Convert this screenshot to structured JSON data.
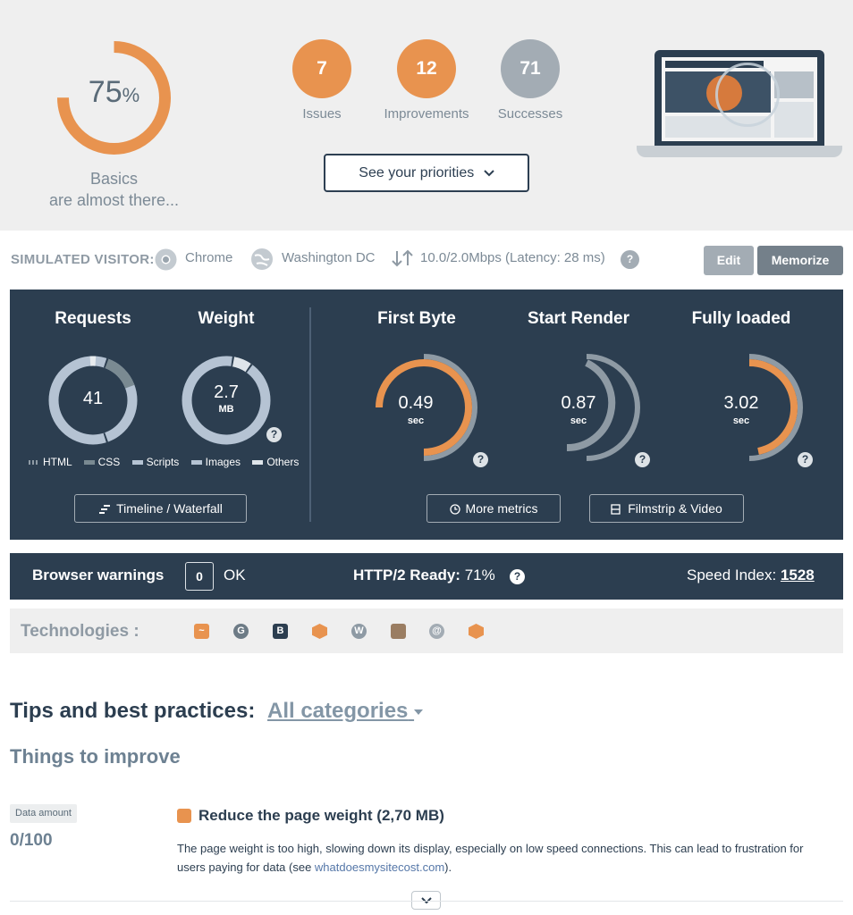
{
  "summary": {
    "score": "75",
    "score_unit": "%",
    "score_fraction": 0.75,
    "basics_line1": "Basics",
    "basics_line2": "are almost there...",
    "issues_count": "7",
    "issues_label": "Issues",
    "improvements_count": "12",
    "improvements_label": "Improvements",
    "successes_count": "71",
    "successes_label": "Successes",
    "priorities_button": "See your priorities"
  },
  "visitor": {
    "label": "SIMULATED VISITOR:",
    "browser": "Chrome",
    "location": "Washington DC",
    "connection": "10.0/2.0Mbps (Latency: 28 ms)",
    "edit_button": "Edit",
    "memorize_button": "Memorize"
  },
  "metrics": {
    "requests_title": "Requests",
    "requests_value": "41",
    "weight_title": "Weight",
    "weight_value": "2.7",
    "weight_unit": "MB",
    "legend": [
      "HTML",
      "CSS",
      "Scripts",
      "Images",
      "Others"
    ],
    "timeline_button": "Timeline / Waterfall",
    "first_byte_title": "First Byte",
    "first_byte_value": "0.49",
    "start_render_title": "Start Render",
    "start_render_value": "0.87",
    "fully_loaded_title": "Fully loaded",
    "fully_loaded_value": "3.02",
    "sec": "sec",
    "more_metrics_button": "More metrics",
    "filmstrip_button": "Filmstrip & Video"
  },
  "warnings": {
    "browser_warnings_label": "Browser warnings",
    "browser_warnings_count": "0",
    "ok": "OK",
    "http2_label": "HTTP/2 Ready:",
    "http2_value": "71%",
    "speed_index_label": "Speed Index:",
    "speed_index_value": "1528"
  },
  "technologies": {
    "label": "Technologies :",
    "icons": [
      "chart-icon",
      "g-icon",
      "bootstrap-icon",
      "hexagon-icon",
      "wordpress-icon",
      "box-icon",
      "swirl-icon",
      "hexagon-icon"
    ]
  },
  "tips": {
    "title": "Tips and best practices:",
    "category": "All categories",
    "subtitle": "Things to improve",
    "tag": "Data amount",
    "score": "0/100",
    "rule_title": "Reduce the page weight (2,70 MB)",
    "rule_desc_1": "The page weight is too high, slowing down its display, especially on low speed connections. This can lead to frustration for users paying for data (see ",
    "rule_link": "whatdoesmysitecost.com",
    "rule_desc_2": ")."
  },
  "colors": {
    "orange": "#e8934f",
    "navy": "#2c3e50",
    "grey": "#a3acb4"
  }
}
